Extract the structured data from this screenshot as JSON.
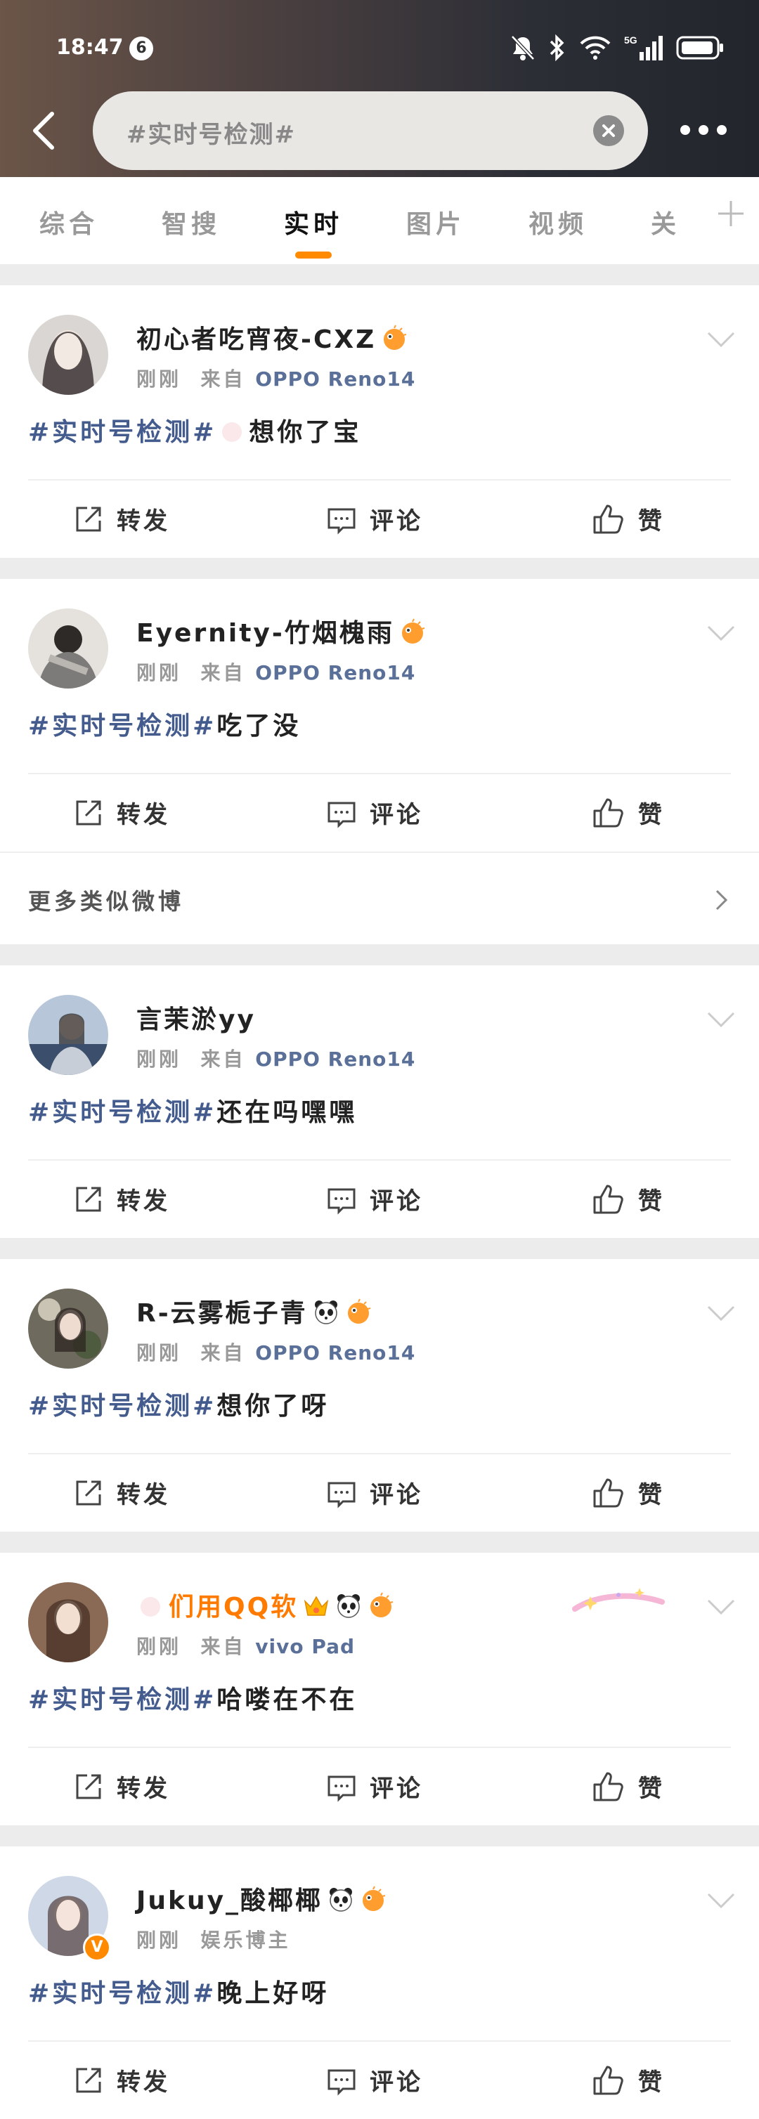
{
  "status_bar": {
    "time": "18:47",
    "notification_count": "6",
    "icons": [
      "mute-bell-icon",
      "bluetooth-icon",
      "wifi-icon",
      "5g-signal-icon",
      "battery-icon"
    ]
  },
  "search": {
    "query": "#实时号检测#"
  },
  "tabs": [
    "综合",
    "智搜",
    "实时",
    "图片",
    "视频",
    "关"
  ],
  "active_tab": "实时",
  "accent_color": "#ff8a00",
  "topic_color": "#445b8e",
  "action_labels": {
    "repost": "转发",
    "comment": "评论",
    "like": "赞"
  },
  "more_similar": "更多类似微博",
  "posts": [
    {
      "name": "初心者吃宵夜-CXZ",
      "time": "刚刚",
      "from": "来自",
      "device": "OPPO Reno14",
      "tag": "#实时号检测#",
      "text": "想你了宝",
      "name_emojis": [
        "pufferfish-icon"
      ]
    },
    {
      "name": "Eyernity-竹烟槐雨",
      "time": "刚刚",
      "from": "来自",
      "device": "OPPO Reno14",
      "tag": "#实时号检测#",
      "text": "吃了没",
      "name_emojis": [
        "pufferfish-icon"
      ]
    },
    {
      "name": "言茉淤yy",
      "time": "刚刚",
      "from": "来自",
      "device": "OPPO Reno14",
      "tag": "#实时号检测#",
      "text": "还在吗嘿嘿",
      "name_emojis": []
    },
    {
      "name": "R-云雾栀子青",
      "time": "刚刚",
      "from": "来自",
      "device": "OPPO Reno14",
      "tag": "#实时号检测#",
      "text": "想你了呀",
      "name_emojis": [
        "panda-icon",
        "pufferfish-icon"
      ]
    },
    {
      "name": "们用QQ软",
      "time": "刚刚",
      "from": "来自",
      "device": "vivo Pad",
      "tag": "#实时号检测#",
      "text": "哈喽在不在",
      "name_emojis": [
        "crown-icon",
        "panda-icon",
        "pufferfish-icon"
      ]
    },
    {
      "name": "Jukuy_酸椰椰",
      "time": "刚刚",
      "from": "",
      "device": "娱乐博主",
      "tag": "#实时号检测#",
      "text": "晚上好呀",
      "name_emojis": [
        "panda-icon",
        "pufferfish-icon"
      ],
      "verified_badge": "V"
    }
  ]
}
